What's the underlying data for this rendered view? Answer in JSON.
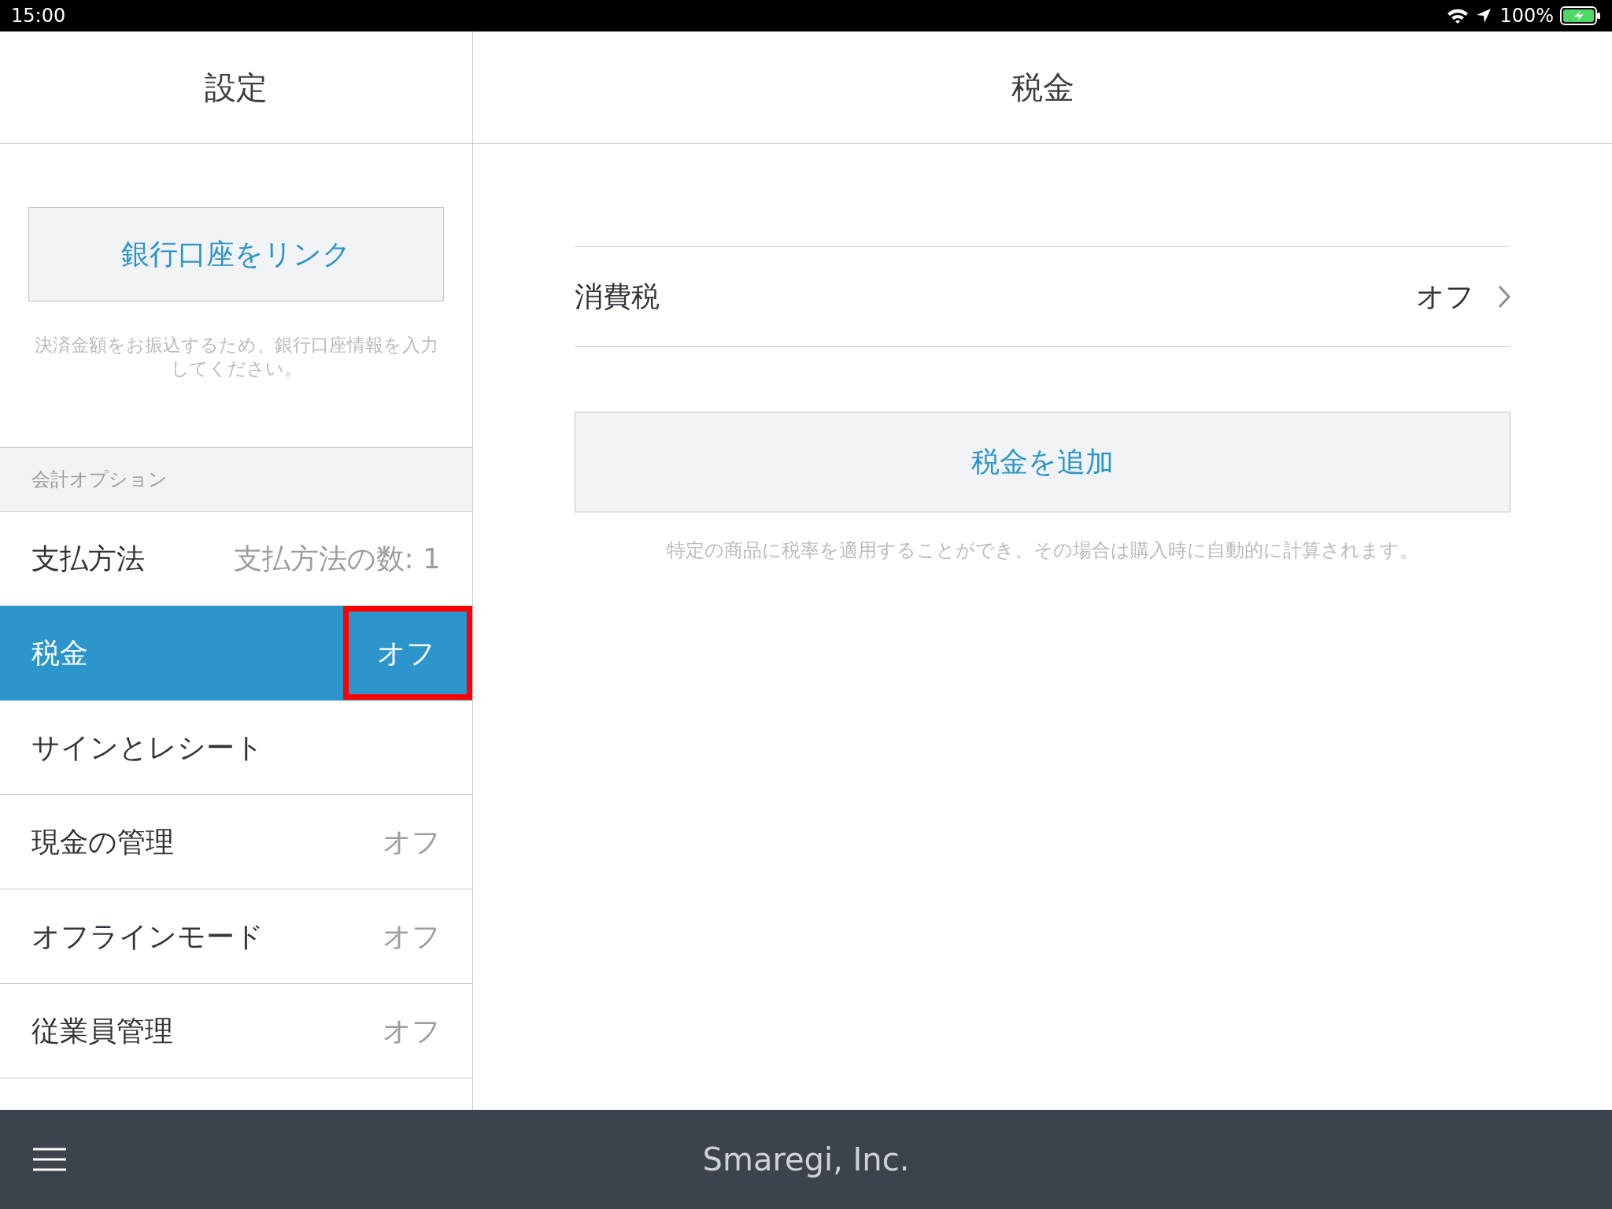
{
  "status_bar": {
    "time": "15:00",
    "battery": "100%"
  },
  "sidebar": {
    "title": "設定",
    "bank_button": "銀行口座をリンク",
    "bank_hint": "決済金額をお振込するため、銀行口座情報を入力してください。",
    "section": "会計オプション",
    "items": [
      {
        "label": "支払方法",
        "value": "支払方法の数: 1",
        "selected": false
      },
      {
        "label": "税金",
        "value": "オフ",
        "selected": true,
        "highlighted": true
      },
      {
        "label": "サインとレシート",
        "selected": false
      },
      {
        "label": "現金の管理",
        "value": "オフ",
        "selected": false
      },
      {
        "label": "オフラインモード",
        "value": "オフ",
        "selected": false
      },
      {
        "label": "従業員管理",
        "value": "オフ",
        "selected": false
      }
    ]
  },
  "main": {
    "title": "税金",
    "rows": [
      {
        "label": "消費税",
        "value": "オフ"
      }
    ],
    "add_button": "税金を追加",
    "hint": "特定の商品に税率を適用することができ、その場合は購入時に自動的に計算されます。"
  },
  "footer": {
    "text": "Smaregi, Inc."
  }
}
